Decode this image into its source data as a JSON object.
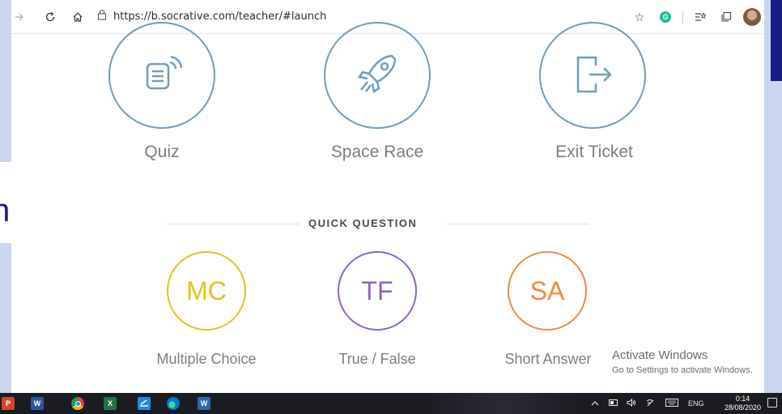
{
  "browser": {
    "url": "https://b.socrative.com/teacher/#launch"
  },
  "launch": {
    "activities": [
      {
        "label": "Quiz",
        "icon": "quiz-icon"
      },
      {
        "label": "Space Race",
        "icon": "rocket-icon"
      },
      {
        "label": "Exit Ticket",
        "icon": "exit-icon"
      }
    ],
    "quick_question": {
      "title": "QUICK QUESTION",
      "items": [
        {
          "abbr": "MC",
          "label": "Multiple Choice",
          "color": "#e2c31a"
        },
        {
          "abbr": "TF",
          "label": "True / False",
          "color": "#8a63c9"
        },
        {
          "abbr": "SA",
          "label": "Short Answer",
          "color": "#f08a3c"
        }
      ]
    }
  },
  "watermark": {
    "title": "Activate Windows",
    "subtitle": "Go to Settings to activate Windows."
  },
  "taskbar": {
    "apps": [
      "powerpoint-icon",
      "word-icon",
      "chrome-icon",
      "excel-icon",
      "classroom-icon",
      "edge-icon",
      "whiteboard-icon"
    ],
    "language": "ENG",
    "time": "0:14",
    "date": "28/08/2020"
  },
  "colors": {
    "activity_ring": "#6f9dba",
    "label_gray": "#7d7d7d",
    "slide_bg": "#c9d6ee",
    "slide_accent": "#1a1a8c"
  }
}
